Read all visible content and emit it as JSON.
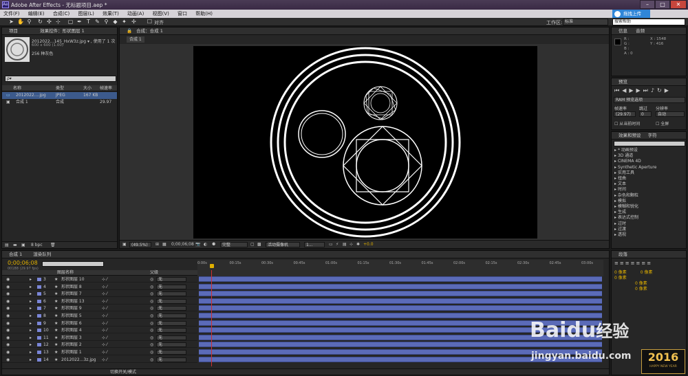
{
  "window": {
    "title": "Adobe After Effects - 无标题项目.aep *",
    "app_icon": "Ae"
  },
  "menu": [
    "文件(F)",
    "编辑(E)",
    "合成(C)",
    "图层(L)",
    "效果(T)",
    "动画(A)",
    "视图(V)",
    "窗口",
    "帮助(H)"
  ],
  "baidu_upload": "拖拽上传",
  "toolbar": {
    "snap_label": "对齐",
    "workspace_label": "工作区:",
    "workspace_value": "标准",
    "search_placeholder": "搜索帮助"
  },
  "project": {
    "tab_project": "项目",
    "tab_effects": "效果控件：形状图层 1",
    "file_name": "2012022...145_HxW3z.jpg ▾ , 使用了 1 次",
    "file_size": "600 x 600 (1.00)",
    "file_color": "256 种灰色",
    "search_placeholder": "ρ▾",
    "headers": [
      "名称",
      "类型",
      "大小",
      "帧速率"
    ],
    "items": [
      {
        "name": "2012022....jpg",
        "type": "JPEG",
        "size": "167 KB",
        "fps": ""
      },
      {
        "name": "合成 1",
        "type": "合成",
        "size": "",
        "fps": "29.97"
      }
    ],
    "bpc": "8 bpc"
  },
  "composition": {
    "tab": "合成：合成 1",
    "sub_tab": "合成 1",
    "zoom": "(49.5%)",
    "timecode": "0;00;06;08",
    "resolution": "完整",
    "camera": "活动摄像机",
    "views": "1...",
    "exposure": "+0.0"
  },
  "info": {
    "tab_info": "信息",
    "tab_audio": "音频",
    "r": "R :",
    "g": "G :",
    "b": "B :",
    "a": "A : 0",
    "x": "X : 1548",
    "y": "Y : 416"
  },
  "preview": {
    "tab": "预览",
    "ram": "RAM 预览选项",
    "framerate_label": "帧速率",
    "skip_label": "跳过",
    "resolution_label": "分辨率",
    "framerate": "(29.97)",
    "skip": "0",
    "resolution": "自动",
    "from_current": "从当前时间",
    "fullscreen": "全屏"
  },
  "effects": {
    "tab": "效果和预设",
    "tab_char": "字符",
    "items": [
      "* 动画预设",
      "3D 通道",
      "CINEMA 4D",
      "Synthetic Aperture",
      "实用工具",
      "扭曲",
      "文本",
      "时间",
      "杂色和颗粒",
      "模拟",
      "模糊和锐化",
      "生成",
      "表达式控制",
      "过时",
      "过渡",
      "透视"
    ]
  },
  "paragraph": {
    "tab": "段落",
    "fields": [
      "0 像素",
      "0 像素",
      "0 像素",
      "0 像素",
      "0 像素"
    ]
  },
  "timeline": {
    "tab_comp": "合成 1",
    "tab_render": "渲染队列",
    "timecode": "0;00;06;08",
    "fps": "00188 (29.97 fps)",
    "header_name": "图层名称",
    "header_parent": "父级",
    "ticks": [
      "0:00s",
      "00:15s",
      "00:30s",
      "00:45s",
      "01:00s",
      "01:15s",
      "01:30s",
      "01:45s",
      "02:00s",
      "02:15s",
      "02:30s",
      "02:45s",
      "03:00s"
    ],
    "layers": [
      {
        "num": "3",
        "name": "形状图层 10",
        "parent": "无"
      },
      {
        "num": "4",
        "name": "形状图层 8",
        "parent": "无"
      },
      {
        "num": "5",
        "name": "形状图层 7",
        "parent": "无"
      },
      {
        "num": "6",
        "name": "形状图层 13",
        "parent": "无"
      },
      {
        "num": "7",
        "name": "形状图层 9",
        "parent": "无"
      },
      {
        "num": "8",
        "name": "形状图层 5",
        "parent": "无"
      },
      {
        "num": "9",
        "name": "形状图层 6",
        "parent": "无"
      },
      {
        "num": "10",
        "name": "形状图层 4",
        "parent": "无"
      },
      {
        "num": "11",
        "name": "形状图层 3",
        "parent": "无"
      },
      {
        "num": "12",
        "name": "形状图层 2",
        "parent": "无"
      },
      {
        "num": "13",
        "name": "形状图层 1",
        "parent": "无"
      },
      {
        "num": "14",
        "name": "2012022...3z.jpg",
        "parent": "无"
      }
    ],
    "footer": "切换开关/模式"
  },
  "watermark": {
    "brand": "Baidu",
    "brand2": "经验",
    "url": "jingyan.baidu.com",
    "year": "2016",
    "year_sub": "HAPPY NEW YEAR"
  }
}
